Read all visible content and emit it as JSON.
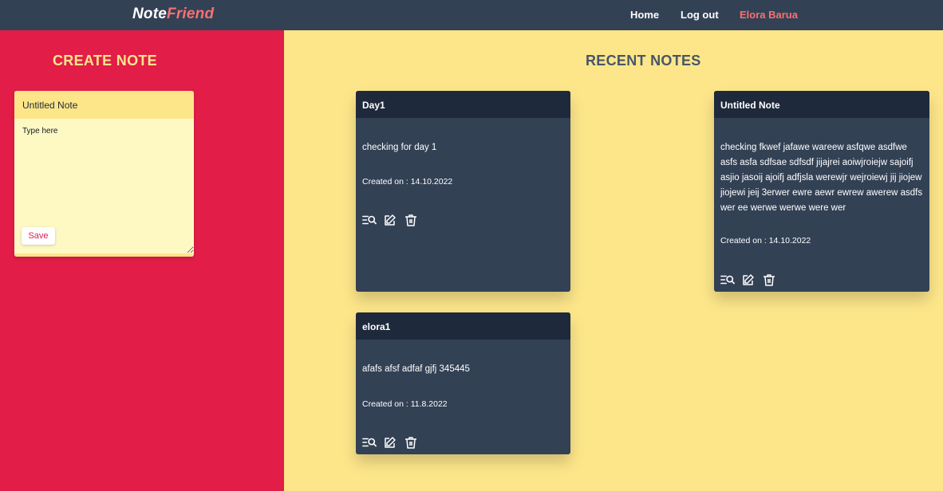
{
  "nav": {
    "brand_part1": "Note",
    "brand_part2": "Friend",
    "links": [
      "Home",
      "Log out"
    ],
    "user": "Elora Barua"
  },
  "create": {
    "heading": "CREATE NOTE",
    "title_value": "Untitled Note",
    "body_placeholder": "Type here",
    "save_label": "Save"
  },
  "recent": {
    "heading": "RECENT NOTES",
    "notes": [
      {
        "title": "Day1",
        "body": "checking for day 1",
        "date_label": "Created on :",
        "date": "14.10.2022"
      },
      {
        "title": "Untitled Note",
        "body": "checking fkwef jafawe wareew asfqwe asdfwe asfs asfa sdfsae sdfsdf jijajrei aoiwjroiejw sajoifj asjio jasoij ajoifj adfjsla werewjr wejroiewj jij jiojew jiojewi jeij 3erwer ewre aewr ewrew awerew asdfs wer ee werwe werwe were wer",
        "date_label": "Created on :",
        "date": "14.10.2022"
      },
      {
        "title": "elora1",
        "body": "afafs afsf adfaf gjfj 345445",
        "date_label": "Created on :",
        "date": "11.8.2022"
      }
    ]
  },
  "icons": {
    "view": "list-search-icon",
    "edit": "edit-icon",
    "delete": "trash-icon"
  },
  "colors": {
    "navbar": "#334155",
    "accent_red": "#e11d48",
    "background_yellow": "#fde68a",
    "card": "#334155",
    "card_header": "#1e293b",
    "brand_accent": "#f87171"
  }
}
